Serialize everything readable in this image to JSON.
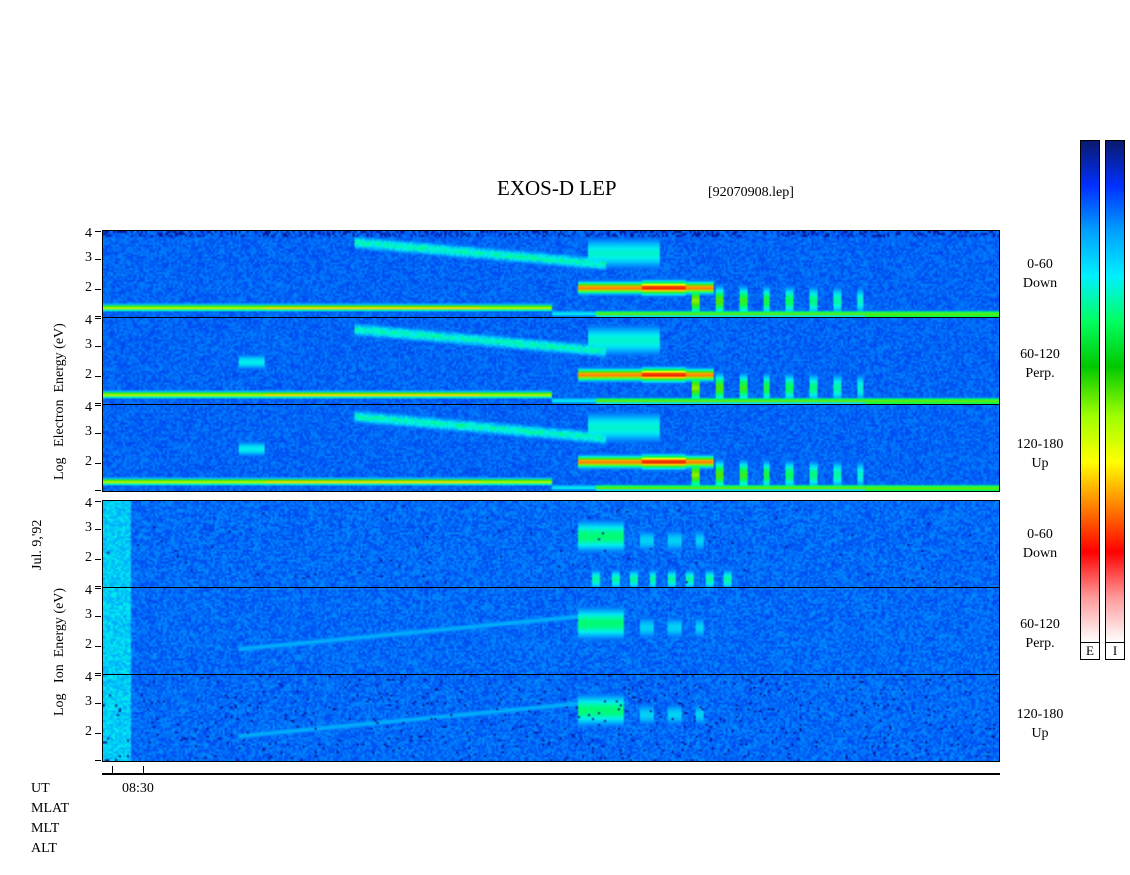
{
  "header": {
    "title": "EXOS-D LEP",
    "file": "[92070908.lep]"
  },
  "left_labels": {
    "date": "Jul. 9,'92",
    "electron": [
      "Log",
      "Electron",
      "Energy",
      "(eV)"
    ],
    "ion": [
      "Log",
      "Ion",
      "Energy",
      "(eV)"
    ]
  },
  "colorbar": {
    "labels": [
      "E",
      "I"
    ],
    "colors": [
      "#0a1a6e",
      "#0030ff",
      "#00a0ff",
      "#00f0ff",
      "#00ff60",
      "#00c800",
      "#a0ff00",
      "#ffff00",
      "#ff8000",
      "#ff0000",
      "#ff9898",
      "#ffffff"
    ]
  },
  "bottom_axis": {
    "rows": [
      "UT",
      "MLAT",
      "MLT",
      "ALT"
    ],
    "ticks": [
      "08:30"
    ]
  },
  "chart_data": {
    "type": "heatmap",
    "y_ticks": [
      "4",
      "3",
      "2"
    ],
    "y_range": [
      1,
      4
    ],
    "panels": [
      {
        "species": "Electron",
        "pitch_angle": "0-60",
        "direction": "Down"
      },
      {
        "species": "Electron",
        "pitch_angle": "60-120",
        "direction": "Perp."
      },
      {
        "species": "Electron",
        "pitch_angle": "120-180",
        "direction": "Up"
      },
      {
        "species": "Ion",
        "pitch_angle": "0-60",
        "direction": "Down"
      },
      {
        "species": "Ion",
        "pitch_angle": "60-120",
        "direction": "Perp."
      },
      {
        "species": "Ion",
        "pitch_angle": "120-180",
        "direction": "Up"
      }
    ]
  }
}
